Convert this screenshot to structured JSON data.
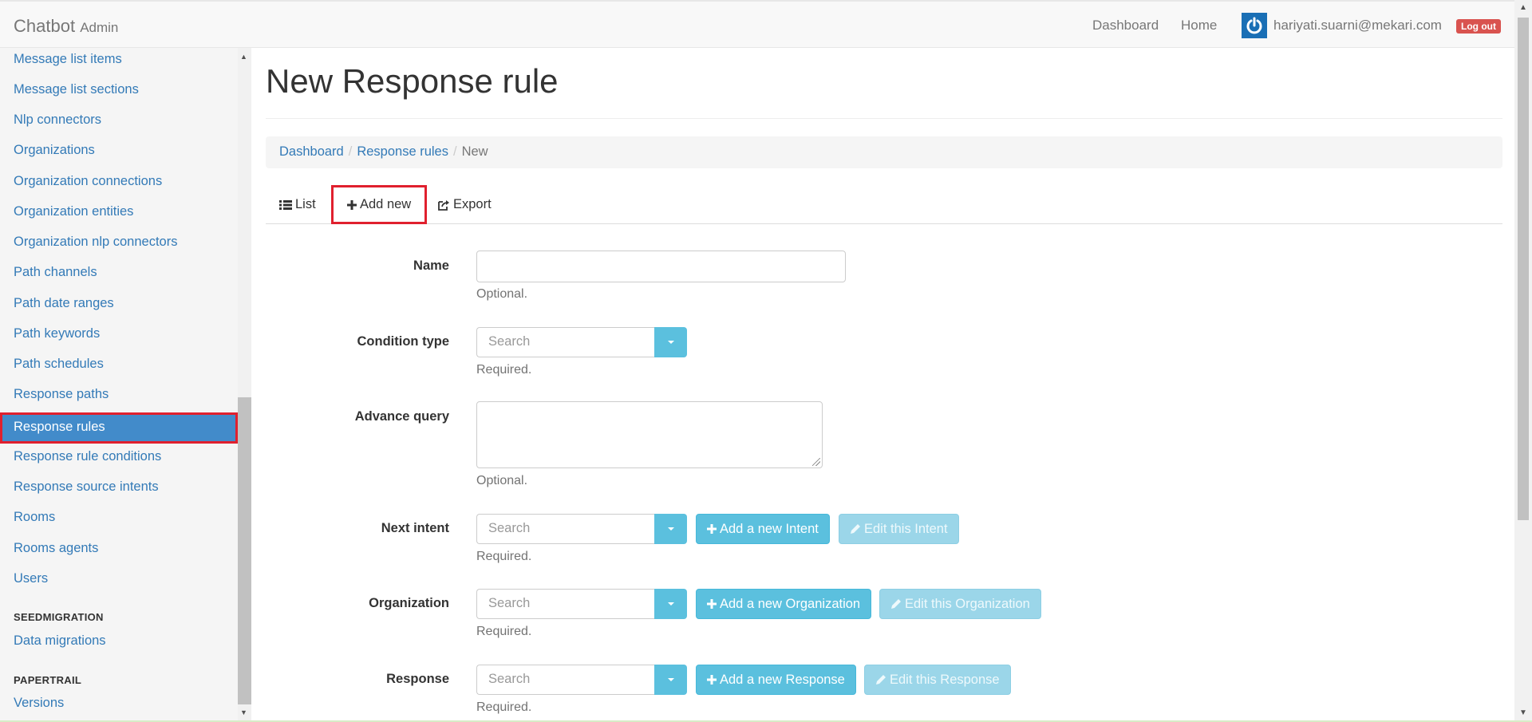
{
  "navbar": {
    "brand": "Chatbot",
    "brand_sub": "Admin",
    "links": [
      "Dashboard",
      "Home"
    ],
    "user_email": "hariyati.suarni@mekari.com",
    "logout": "Log out"
  },
  "sidebar": {
    "items": [
      "Message list items",
      "Message list sections",
      "Nlp connectors",
      "Organizations",
      "Organization connections",
      "Organization entities",
      "Organization nlp connectors",
      "Path channels",
      "Path date ranges",
      "Path keywords",
      "Path schedules",
      "Response paths",
      "Response rules",
      "Response rule conditions",
      "Response source intents",
      "Rooms",
      "Rooms agents",
      "Users"
    ],
    "active_item": "Response rules",
    "sections": [
      {
        "header": "SEEDMIGRATION",
        "items": [
          "Data migrations"
        ]
      },
      {
        "header": "PAPERTRAIL",
        "items": [
          "Versions"
        ]
      }
    ]
  },
  "page": {
    "title": "New Response rule",
    "breadcrumb": [
      "Dashboard",
      "Response rules",
      "New"
    ]
  },
  "tabs": [
    "List",
    "Add new",
    "Export"
  ],
  "form": {
    "search_placeholder": "Search",
    "fields": [
      {
        "label": "Name",
        "help": "Optional."
      },
      {
        "label": "Condition type",
        "help": "Required."
      },
      {
        "label": "Advance query",
        "help": "Optional."
      },
      {
        "label": "Next intent",
        "help": "Required.",
        "add": "Add a new Intent",
        "edit": "Edit this Intent"
      },
      {
        "label": "Organization",
        "help": "Required.",
        "add": "Add a new Organization",
        "edit": "Edit this Organization"
      },
      {
        "label": "Response",
        "help": "Required.",
        "add": "Add a new Response",
        "edit": "Edit this Response"
      }
    ]
  },
  "colors": {
    "link": "#337ab7",
    "active_bg": "#428bca",
    "highlight_border": "#e0202e",
    "info": "#5bc0de",
    "danger": "#d9534f"
  }
}
